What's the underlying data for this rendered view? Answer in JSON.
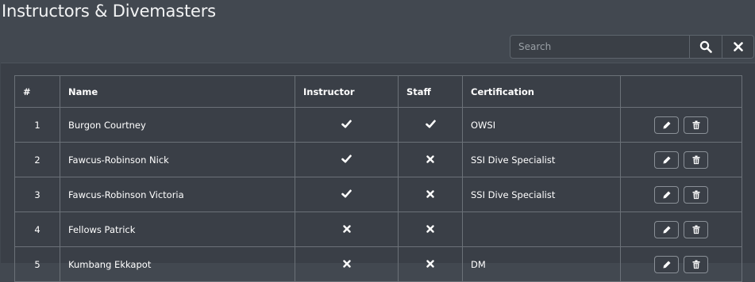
{
  "page": {
    "title": "Instructors & Divemasters"
  },
  "search": {
    "placeholder": "Search",
    "value": ""
  },
  "table": {
    "headers": {
      "num": "#",
      "name": "Name",
      "instructor": "Instructor",
      "staff": "Staff",
      "certification": "Certification",
      "actions": ""
    },
    "rows": [
      {
        "num": "1",
        "name": "Burgon Courtney",
        "instructor": true,
        "staff": true,
        "certification": "OWSI"
      },
      {
        "num": "2",
        "name": "Fawcus-Robinson Nick",
        "instructor": true,
        "staff": false,
        "certification": "SSI Dive Specialist"
      },
      {
        "num": "3",
        "name": "Fawcus-Robinson Victoria",
        "instructor": true,
        "staff": false,
        "certification": "SSI Dive Specialist"
      },
      {
        "num": "4",
        "name": "Fellows Patrick",
        "instructor": false,
        "staff": false,
        "certification": ""
      },
      {
        "num": "5",
        "name": "Kumbang Ekkapot",
        "instructor": false,
        "staff": false,
        "certification": "DM"
      }
    ]
  },
  "icons": {
    "search": "search-icon",
    "clear": "close-icon",
    "edit": "pencil-icon",
    "delete": "trash-icon",
    "yes": "check-icon",
    "no": "cross-icon"
  },
  "colors": {
    "background": "#424850",
    "panel": "#3a3f47",
    "border": "#6b7178",
    "text": "#ffffff"
  }
}
